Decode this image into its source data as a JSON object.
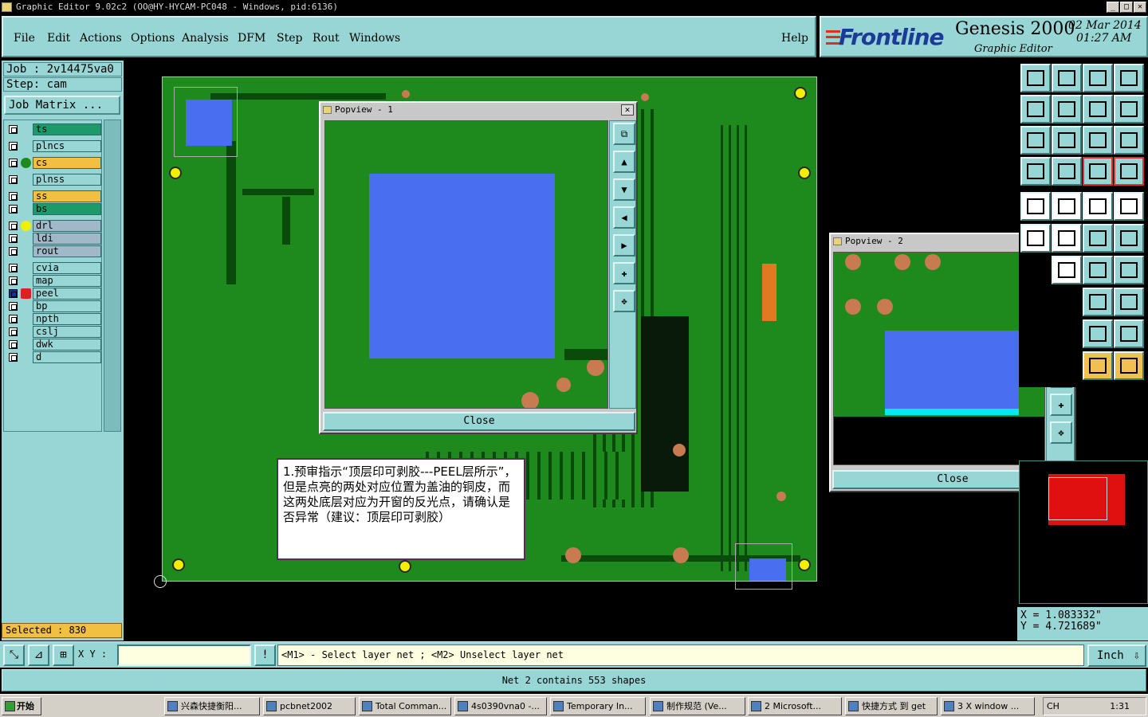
{
  "window": {
    "title": "Graphic Editor 9.02c2  (OO@HY-HYCAM-PC048 - Windows, pid:6136)",
    "min": "_",
    "max": "□",
    "close": "✕"
  },
  "menu": [
    "File",
    "Edit",
    "Actions",
    "Options",
    "Analysis",
    "DFM",
    "Step",
    "Rout",
    "Windows"
  ],
  "help": "Help",
  "brand": {
    "logo": "Frontline",
    "product": "Genesis 2000",
    "subtitle": "Graphic Editor",
    "date": "02 Mar 2014",
    "time": "01:27 AM"
  },
  "job": {
    "job_label": "Job : 2v14475va0",
    "step_label": "Step: cam",
    "matrix_button": "Job Matrix ..."
  },
  "layers": [
    {
      "name": "ts",
      "color": "#1e9a6a"
    },
    {
      "name": "plncs",
      "color": "#98d6d6"
    },
    {
      "name": "cs",
      "color": "#f2c040"
    },
    {
      "name": "plnss",
      "color": "#98d6d6"
    },
    {
      "name": "ss",
      "color": "#f2c040"
    },
    {
      "name": "bs",
      "color": "#1e9a6a"
    },
    {
      "name": "drl",
      "color": "#a0b8c8"
    },
    {
      "name": "ldi",
      "color": "#a0b8c8"
    },
    {
      "name": "rout",
      "color": "#a0b8c8"
    },
    {
      "name": "cvia",
      "color": "#98d6d6"
    },
    {
      "name": "map",
      "color": "#98d6d6"
    },
    {
      "name": "peel",
      "color": "#98d6d6"
    },
    {
      "name": "bp",
      "color": "#98d6d6"
    },
    {
      "name": "npth",
      "color": "#98d6d6"
    },
    {
      "name": "cslj",
      "color": "#98d6d6"
    },
    {
      "name": "dwk",
      "color": "#98d6d6"
    },
    {
      "name": "d",
      "color": "#98d6d6"
    }
  ],
  "selected": "Selected : 830",
  "popview1": {
    "title": "Popview - 1",
    "close": "Close"
  },
  "popview2": {
    "title": "Popview - 2",
    "close": "Close"
  },
  "note": "1.预审指示“顶层印可剥胶---PEEL层所示”，但是点亮的两处对应位置为盖油的铜皮，而这两处底层对应为开窗的反光点，请确认是否异常（建议：顶层印可剥胶）",
  "coords": {
    "x": "X = 1.083332\"",
    "y": "Y = 4.721689\""
  },
  "bottom": {
    "xy_label": "X Y :",
    "xy_value": "",
    "warn": "!",
    "hint": "<M1> - Select layer net ; <M2> Unselect layer net",
    "unit": "Inch"
  },
  "status": "Net 2 contains 553 shapes",
  "taskbar": {
    "start": "开始",
    "items": [
      "兴森快捷衡阳...",
      "pcbnet2002",
      "Total Comman...",
      "4s0390vna0 -...",
      "Temporary In...",
      "制作规范  (Ve...",
      "2 Microsoft...",
      "快捷方式 到 get",
      "3 X window ..."
    ],
    "clock": "1:31",
    "lang": "CH"
  },
  "colors": {
    "accent": "#98d6d6",
    "board": "#1e8a1e",
    "peel": "#4a6ef0",
    "highlight": "#f2c040"
  }
}
